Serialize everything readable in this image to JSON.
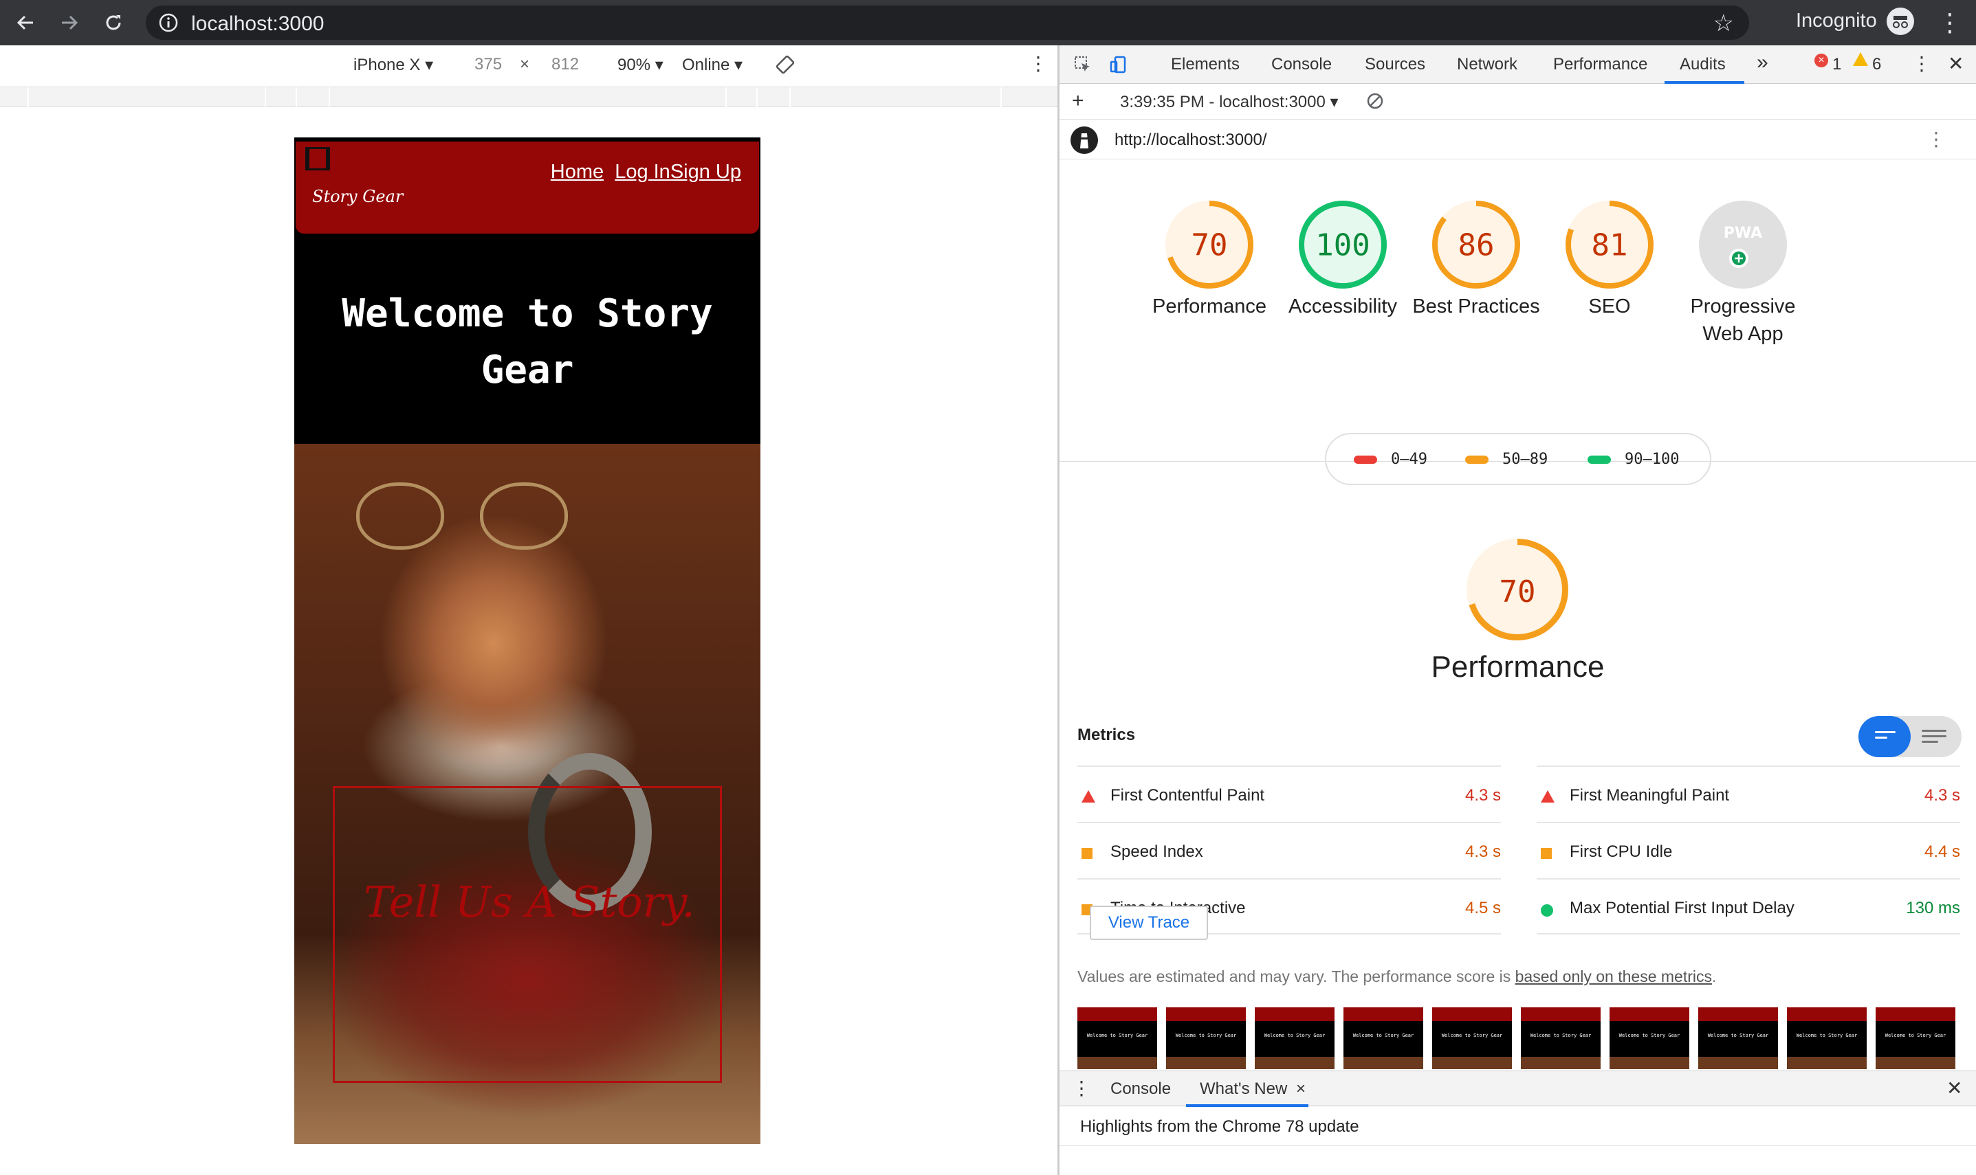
{
  "browser": {
    "url": "localhost:3000",
    "incognito_label": "Incognito"
  },
  "device_toolbar": {
    "device": "iPhone X",
    "width": "375",
    "times": "×",
    "height": "812",
    "zoom": "90%",
    "network": "Online"
  },
  "site": {
    "logo_text": "Story Gear",
    "nav": [
      "Home",
      "Log In",
      "Sign Up"
    ],
    "title": "Welcome to Story Gear",
    "hero_text": "Tell Us A Story."
  },
  "devtools": {
    "tabs": [
      "Elements",
      "Console",
      "Sources",
      "Network",
      "Performance",
      "Audits"
    ],
    "active_tab": "Audits",
    "more_tabs": "»",
    "errors": "1",
    "warnings": "6",
    "report_selector": "3:39:35 PM - localhost:3000",
    "audited_url": "http://localhost:3000/"
  },
  "scores": [
    {
      "value": "70",
      "label": "Performance",
      "color": "#f59e1b"
    },
    {
      "value": "100",
      "label": "Accessibility",
      "color": "#13c16c"
    },
    {
      "value": "86",
      "label": "Best Practices",
      "color": "#f59e1b"
    },
    {
      "value": "81",
      "label": "SEO",
      "color": "#f59e1b"
    },
    {
      "value": "PWA",
      "label": "Progressive Web App",
      "color": "#bdbdbd"
    }
  ],
  "legend": [
    {
      "range": "0–49",
      "color": "#eb3d35"
    },
    {
      "range": "50–89",
      "color": "#f59e1b"
    },
    {
      "range": "90–100",
      "color": "#13c16c"
    }
  ],
  "performance": {
    "score": "70",
    "title": "Performance",
    "metrics_heading": "Metrics",
    "metrics": [
      {
        "name": "First Contentful Paint",
        "value": "4.3 s",
        "status": "fail"
      },
      {
        "name": "First Meaningful Paint",
        "value": "4.3 s",
        "status": "fail"
      },
      {
        "name": "Speed Index",
        "value": "4.3 s",
        "status": "average"
      },
      {
        "name": "First CPU Idle",
        "value": "4.4 s",
        "status": "average"
      },
      {
        "name": "Time to Interactive",
        "value": "4.5 s",
        "status": "average"
      },
      {
        "name": "Max Potential First Input Delay",
        "value": "130 ms",
        "status": "pass"
      }
    ],
    "view_trace": "View Trace",
    "note_prefix": "Values are estimated and may vary. The performance score is ",
    "note_link": "based only on these metrics",
    "note_suffix": ".",
    "thumb_text": "Welcome to Story Gear"
  },
  "drawer": {
    "tabs": [
      "Console",
      "What's New"
    ],
    "close_tab": "×",
    "headline": "Highlights from the Chrome 78 update"
  }
}
